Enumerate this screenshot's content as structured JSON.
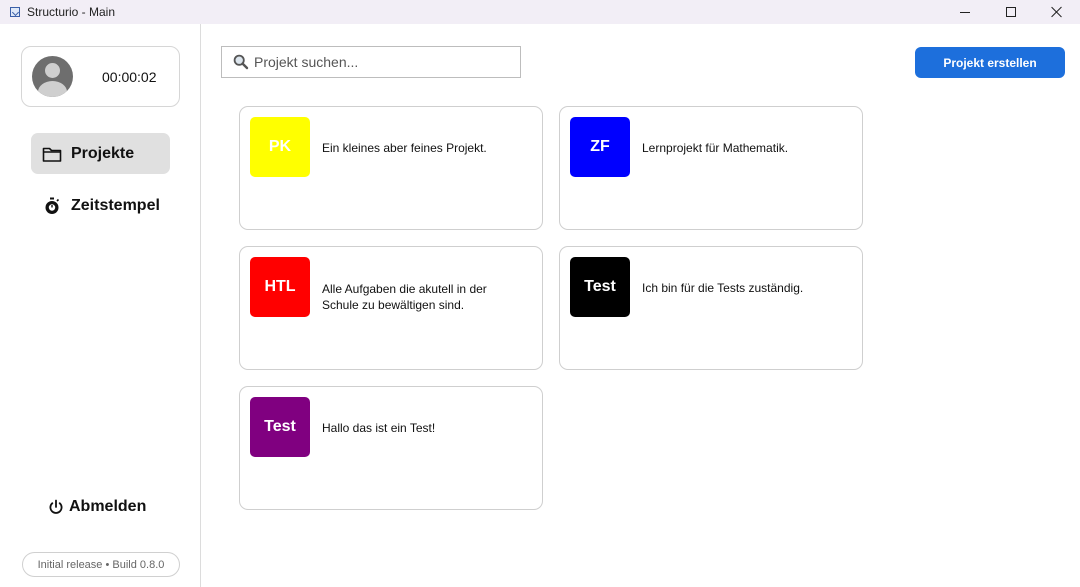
{
  "window": {
    "title": "Structurio - Main"
  },
  "user": {
    "timer": "00:00:02"
  },
  "nav": {
    "projects_label": "Projekte",
    "timestamps_label": "Zeitstempel",
    "logout_label": "Abmelden"
  },
  "build": {
    "label": "Initial release • Build 0.8.0"
  },
  "search": {
    "placeholder": "Projekt suchen..."
  },
  "toolbar": {
    "create_label": "Projekt erstellen"
  },
  "projects": [
    {
      "abbr": "PK",
      "color": "#ffff00",
      "description": "Ein kleines aber feines Projekt."
    },
    {
      "abbr": "ZF",
      "color": "#0000ff",
      "description": "Lernprojekt für Mathematik."
    },
    {
      "abbr": "HTL",
      "color": "#ff0000",
      "description": "Alle Aufgaben die akutell in der Schule zu bewältigen sind."
    },
    {
      "abbr": "Test",
      "color": "#000000",
      "description": "Ich bin für die Tests zuständig."
    },
    {
      "abbr": "Test",
      "color": "#800080",
      "description": "Hallo das ist ein Test!"
    }
  ],
  "colors": {
    "accent": "#1d6fdc",
    "active_nav": "#e0e0e0"
  }
}
